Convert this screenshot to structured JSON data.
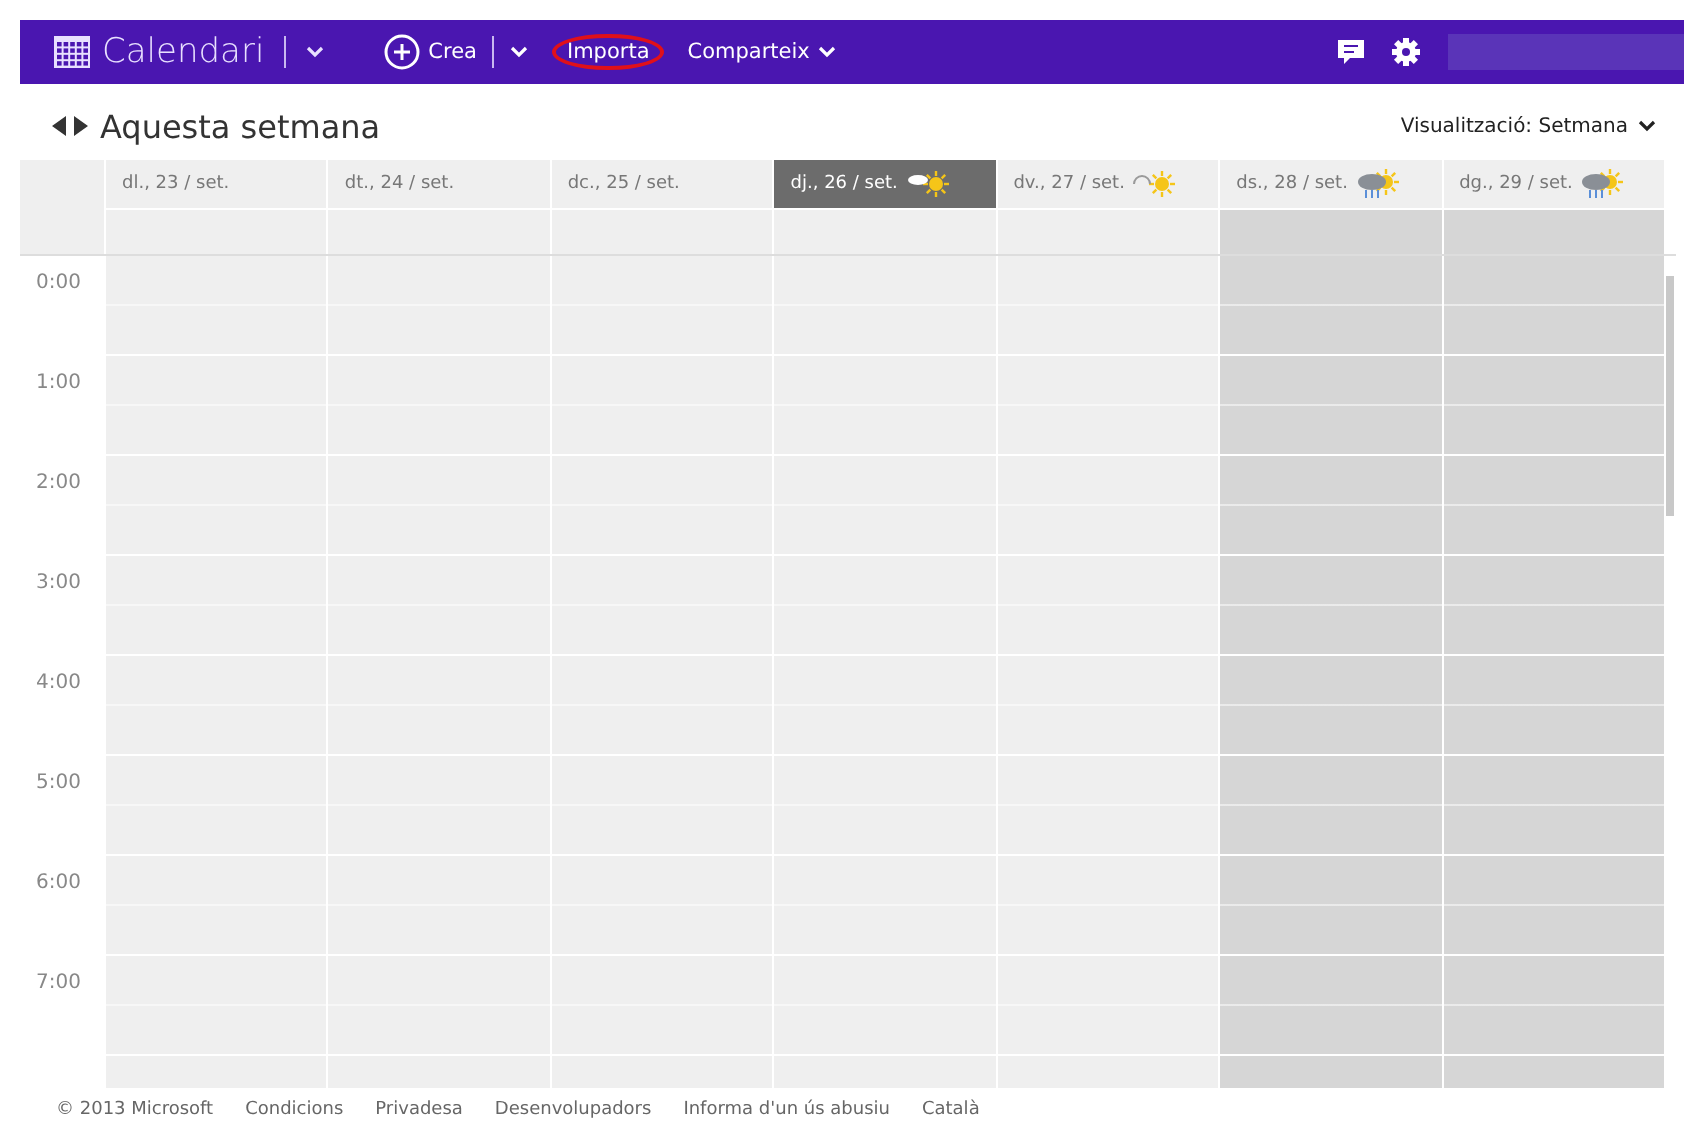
{
  "top_bar": {
    "app_title": "Calendari",
    "menu": [
      {
        "label": "Crea",
        "kind": "create"
      },
      {
        "label": "Importa",
        "kind": "highlighted"
      },
      {
        "label": "Comparteix",
        "kind": "dropdown"
      }
    ]
  },
  "heading": {
    "title": "Aquesta setmana",
    "view_selector": "Visualització: Setmana"
  },
  "days": [
    {
      "label": "dl., 23 / set.",
      "selected": false,
      "weekend": false
    },
    {
      "label": "dt., 24 / set.",
      "selected": false,
      "weekend": false
    },
    {
      "label": "dc., 25 / set.",
      "selected": false,
      "weekend": false
    },
    {
      "label": "dj., 26 / set.",
      "selected": true,
      "weekend": false,
      "weather": {
        "kind": "cloud-sun"
      }
    },
    {
      "label": "dv., 27 / set.",
      "selected": false,
      "weekend": false,
      "weather": {
        "kind": "cloud-outline-sun"
      }
    },
    {
      "label": "ds., 28 / set.",
      "selected": false,
      "weekend": true,
      "weather": {
        "kind": "rain-sun"
      }
    },
    {
      "label": "dg., 29 / set.",
      "selected": false,
      "weekend": true,
      "weather": {
        "kind": "rain-sun"
      }
    }
  ],
  "hours": [
    "0:00",
    "1:00",
    "2:00",
    "3:00",
    "4:00",
    "5:00",
    "6:00",
    "7:00"
  ],
  "footer": [
    "© 2013 Microsoft",
    "Condicions",
    "Privadesa",
    "Desenvolupadors",
    "Informa d'un ús abusiu",
    "Català"
  ]
}
